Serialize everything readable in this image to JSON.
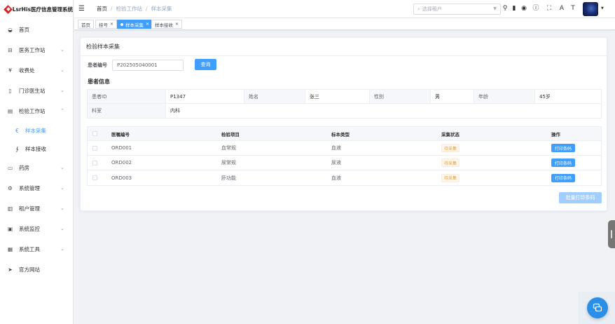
{
  "app": {
    "title": "LsrHis医疗信息管理系统"
  },
  "sidebar": {
    "items": [
      {
        "label": "首页",
        "icon": "dashboard-icon",
        "glyph": "◒"
      },
      {
        "label": "医务工作站",
        "icon": "medical-icon",
        "glyph": "⊟"
      },
      {
        "label": "收费处",
        "icon": "yen-icon",
        "glyph": "¥"
      },
      {
        "label": "门诊医生站",
        "icon": "door-icon",
        "glyph": "▯"
      },
      {
        "label": "检验工作站",
        "icon": "lab-icon",
        "glyph": "▤"
      },
      {
        "label": "药房",
        "icon": "pharmacy-icon",
        "glyph": "▭"
      },
      {
        "label": "系统管理",
        "icon": "gear-icon",
        "glyph": "⚙"
      },
      {
        "label": "租户管理",
        "icon": "chart-icon",
        "glyph": "▥"
      },
      {
        "label": "系统监控",
        "icon": "monitor-icon",
        "glyph": "▣"
      },
      {
        "label": "系统工具",
        "icon": "toolbox-icon",
        "glyph": "▦"
      },
      {
        "label": "官方网站",
        "icon": "send-icon",
        "glyph": "➤"
      }
    ],
    "sub_items": [
      {
        "label": "样本采集",
        "icon": "sample-icon",
        "glyph": "€"
      },
      {
        "label": "样本接收",
        "icon": "receive-icon",
        "glyph": "∱"
      }
    ]
  },
  "header": {
    "breadcrumb": [
      "首页",
      "检验工作站",
      "样本采集"
    ],
    "tenant_placeholder": "选择租户"
  },
  "tags": [
    "首页",
    "挂号",
    "样本采集",
    "样本接收"
  ],
  "card": {
    "title": "检验样本采集",
    "patient_no_label": "患者编号",
    "patient_no_value": "P202505040001",
    "query_label": "查询",
    "section_title": "患者信息",
    "info": {
      "id_label": "患者ID",
      "id_value": "P1347",
      "name_label": "姓名",
      "name_value": "张三",
      "gender_label": "性别",
      "gender_value": "男",
      "age_label": "年龄",
      "age_value": "45岁",
      "dept_label": "科室",
      "dept_value": "内科"
    },
    "table": {
      "headers": [
        "医嘱编号",
        "检验项目",
        "标本类型",
        "采集状态",
        "操作"
      ],
      "rows": [
        {
          "order": "ORD001",
          "item": "血常规",
          "specimen": "血液",
          "status": "待采集",
          "action": "打印条码"
        },
        {
          "order": "ORD002",
          "item": "尿常规",
          "specimen": "尿液",
          "status": "待采集",
          "action": "打印条码"
        },
        {
          "order": "ORD003",
          "item": "肝功能",
          "specimen": "血液",
          "status": "待采集",
          "action": "打印条码"
        }
      ]
    },
    "batch_label": "批量打印条码"
  },
  "colors": {
    "primary": "#409eff",
    "warning": "#e6a23c",
    "brand_red": "#d0262b"
  }
}
